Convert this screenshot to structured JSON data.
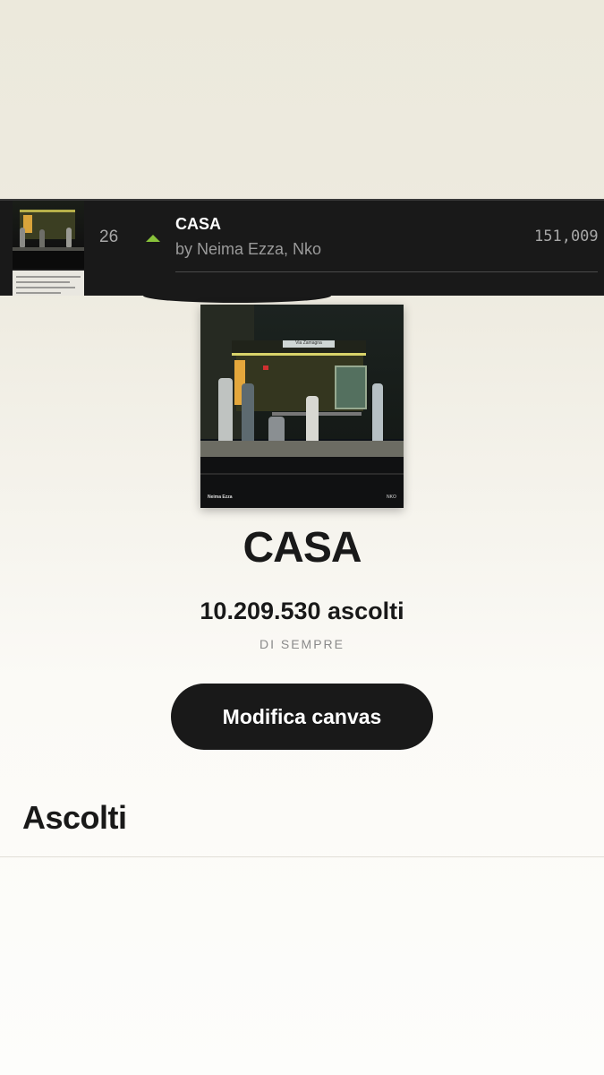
{
  "chart_row": {
    "rank": "26",
    "trend": "up",
    "title": "CASA",
    "artists": "by Neima Ezza, Nko",
    "streams": "151,009",
    "trend_color": "#88c23a"
  },
  "cover": {
    "sign_text": "Via Zamagna",
    "label_left": "Neima Ezza",
    "label_right": "NKO"
  },
  "track": {
    "title": "CASA",
    "plays": "10.209.530 ascolti",
    "period": "DI SEMPRE"
  },
  "actions": {
    "edit_canvas": "Modifica canvas"
  },
  "section": {
    "heading": "Ascolti"
  },
  "colors": {
    "dark": "#191919",
    "muted": "#8a8a8a"
  }
}
